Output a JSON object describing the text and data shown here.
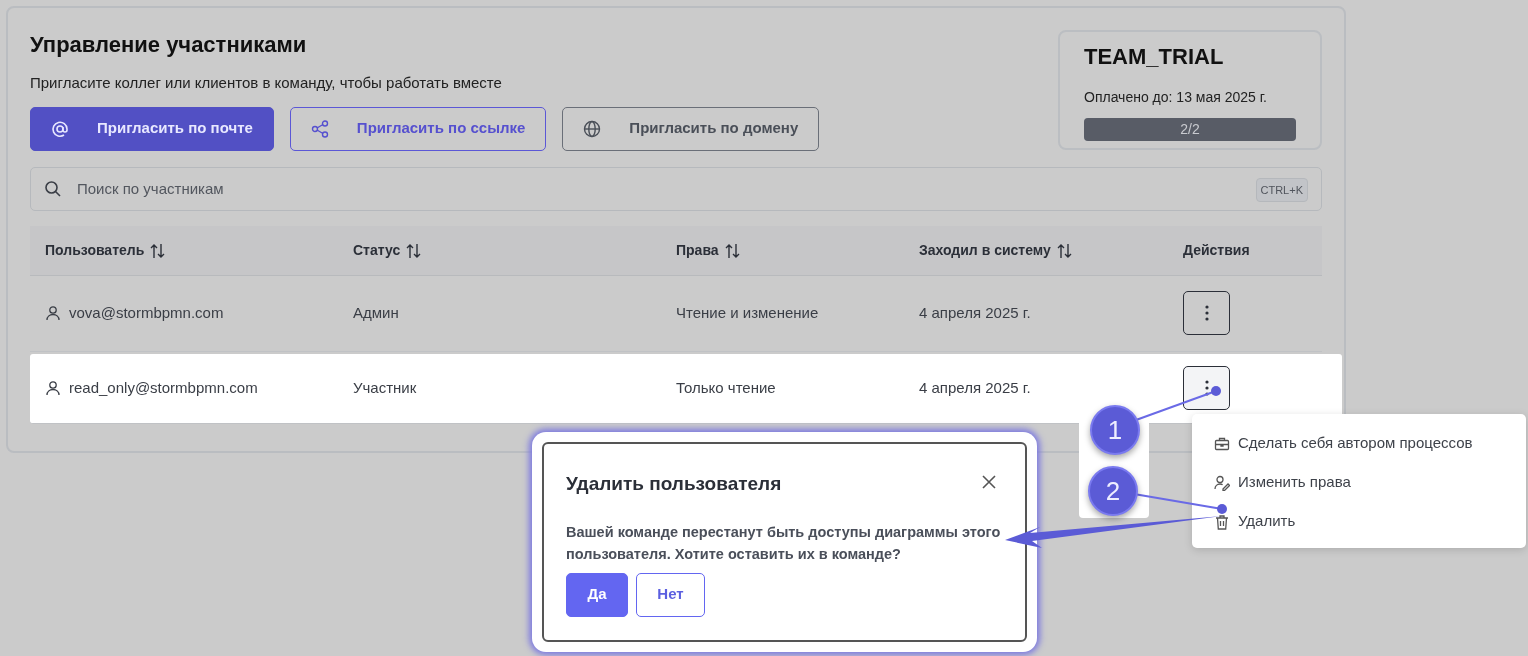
{
  "header": {
    "title": "Управление участниками",
    "subtitle": "Пригласите коллег или клиентов в команду, чтобы работать вместе"
  },
  "invite_buttons": [
    {
      "label": "Пригласить по почте",
      "kind": "email"
    },
    {
      "label": "Пригласить по ссылке",
      "kind": "link"
    },
    {
      "label": "Пригласить по домену",
      "kind": "domain"
    }
  ],
  "plan": {
    "name": "TEAM_TRIAL",
    "paid_until": "Оплачено до: 13 мая 2025 г.",
    "seats": "2/2",
    "level": 1
  },
  "search": {
    "placeholder": "Поиск по участникам",
    "shortcut": "CTRL+K"
  },
  "table": {
    "columns": [
      {
        "label": "Пользователь",
        "sortable": true
      },
      {
        "label": "Статус",
        "sortable": true
      },
      {
        "label": "Права",
        "sortable": true
      },
      {
        "label": "Заходил в систему",
        "sortable": true
      },
      {
        "label": "Действия",
        "sortable": false
      }
    ],
    "rows": [
      {
        "user": "vova@stormbpmn.com",
        "status": "Админ",
        "rights": "Чтение и изменение",
        "last_login": "4 апреля 2025 г.",
        "selected": false
      },
      {
        "user": "read_only@stormbpmn.com",
        "status": "Участник",
        "rights": "Только чтение",
        "last_login": "4 апреля 2025 г.",
        "selected": true
      }
    ]
  },
  "actions_menu": {
    "items": [
      {
        "label": "Сделать себя автором процессов",
        "kind": "author"
      },
      {
        "label": "Изменить права",
        "kind": "rights"
      },
      {
        "label": "Удалить",
        "kind": "delete"
      }
    ]
  },
  "callouts": [
    {
      "label": "1"
    },
    {
      "label": "2"
    }
  ],
  "dialog": {
    "title": "Удалить пользователя",
    "message": "Вашей команде перестанут быть доступы диаграммы этого пользователя. Хотите оставить их в команде?",
    "buttons": [
      {
        "label": "Да",
        "kind": "primary"
      },
      {
        "label": "Нет",
        "kind": "outline"
      }
    ]
  }
}
